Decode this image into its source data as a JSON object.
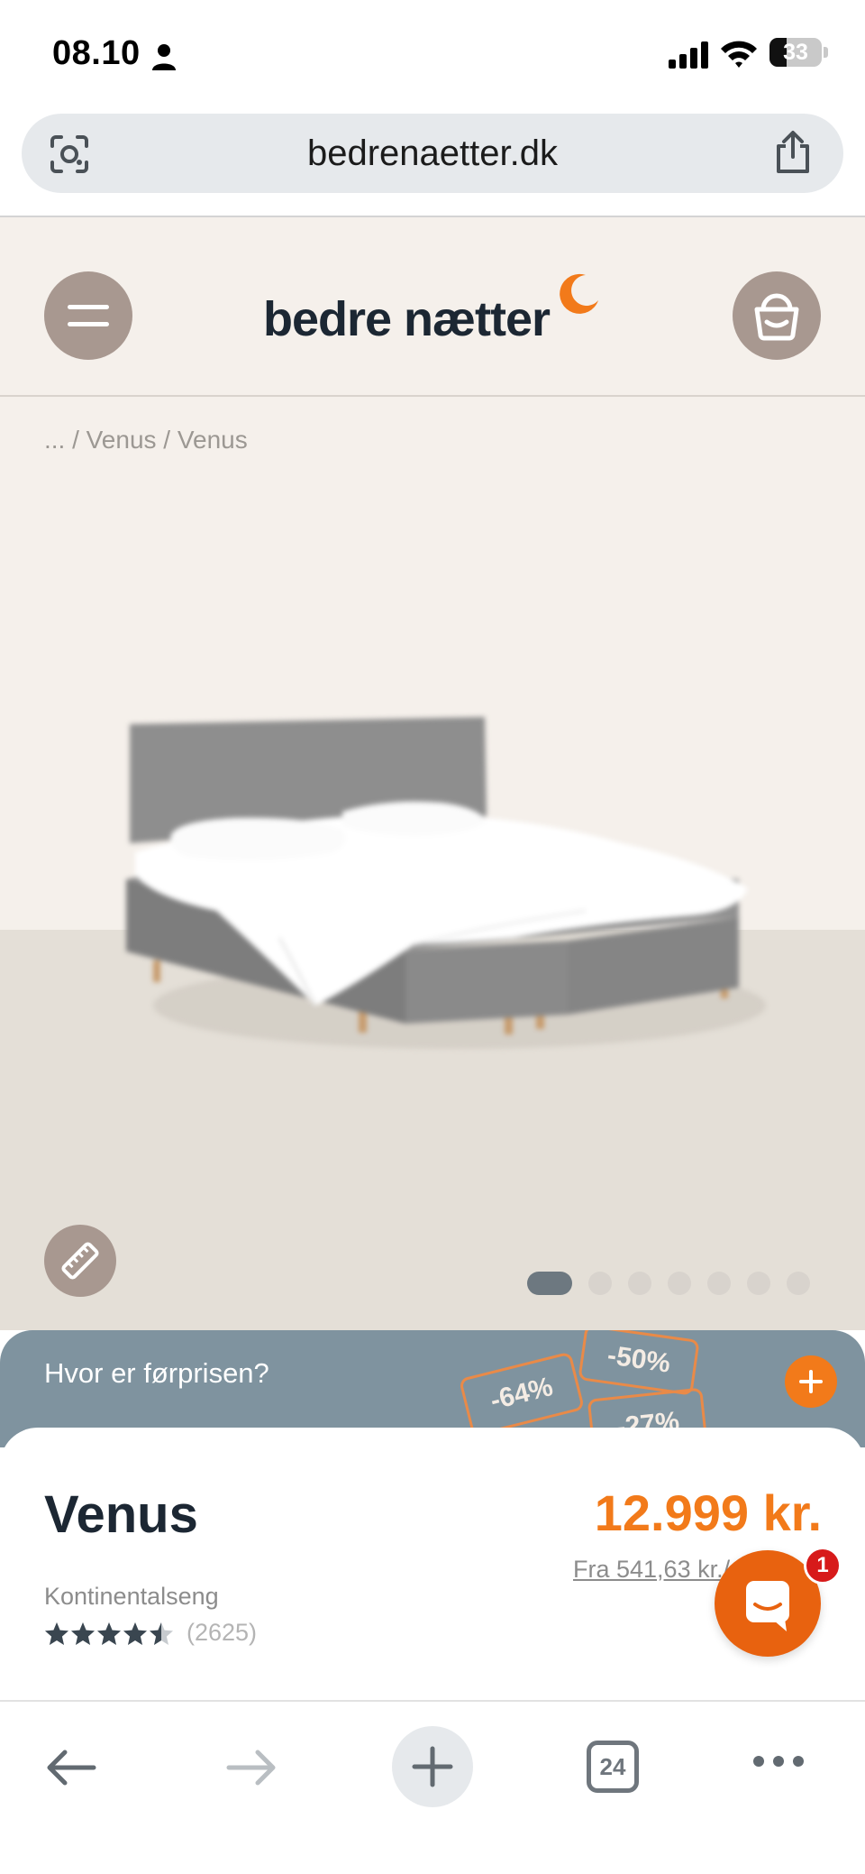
{
  "status_bar": {
    "time": "08.10",
    "battery": "33",
    "battery_level": 0.33
  },
  "browser": {
    "url": "bedrenaetter.dk",
    "tab_count": "24"
  },
  "header": {
    "logo_text": "bedre nætter"
  },
  "breadcrumb": "... / Venus / Venus",
  "gallery": {
    "dot_count": 7,
    "active_dot": 0
  },
  "price_banner": {
    "text": "Hvor er førprisen?",
    "tags": [
      "-64%",
      "-50%",
      "-27%"
    ]
  },
  "product": {
    "name": "Venus",
    "type": "Kontinentalseng",
    "rating": 4.5,
    "review_count": "(2625)",
    "price": "12.999 kr.",
    "monthly": "Fra 541,63 kr./md."
  },
  "chat": {
    "badge": "1"
  },
  "colors": {
    "accent": "#f27a1a",
    "brand_dark": "#1c2733",
    "beige": "#f5f0eb",
    "taupe": "#a89890",
    "banner": "#7f939f"
  }
}
